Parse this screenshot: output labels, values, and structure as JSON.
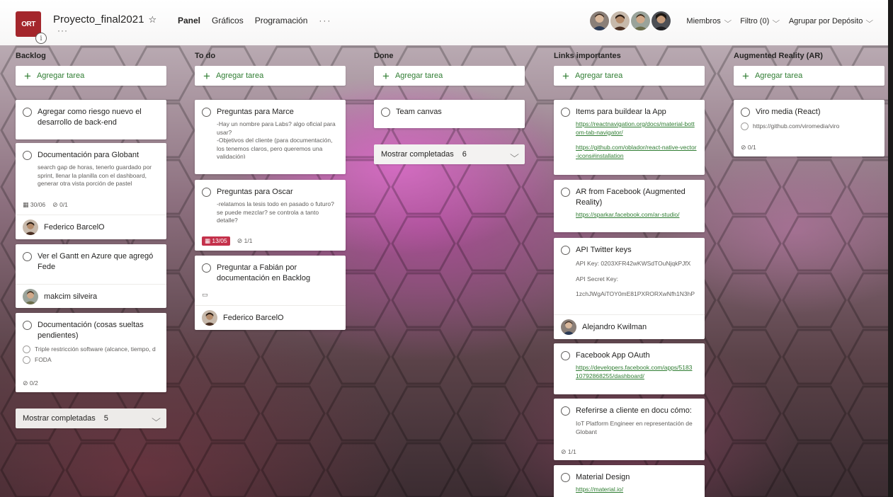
{
  "header": {
    "logo_text": "ORT",
    "info_glyph": "i",
    "plan_title": "Proyecto_final2021",
    "star_glyph": "☆",
    "more_glyph": "···",
    "views": [
      {
        "label": "Panel",
        "active": true
      },
      {
        "label": "Gráficos",
        "active": false
      },
      {
        "label": "Programación",
        "active": false
      }
    ],
    "views_more": "···",
    "members_label": "Miembros",
    "filter_label": "Filtro (0)",
    "group_label": "Agrupar por Depósito",
    "chevron_glyph": "⌵"
  },
  "add_task_label": "Agregar tarea",
  "show_completed_label": "Mostrar completadas",
  "columns": [
    {
      "title": "Backlog",
      "cards": [
        {
          "title": "Agregar como riesgo nuevo el desarrollo de back-end"
        },
        {
          "title": "Documentación para Globant",
          "notes": "search gap de horas, tenerlo guardado por sprint, llenar la planilla con el dashboard, generar otra vista porción de pastel",
          "date": "30/06",
          "checklist": "0/1",
          "assignee": "Federico BarcelO"
        },
        {
          "title": "Ver el Gantt en Azure que agregó Fede",
          "assignee": "makcim silveira"
        },
        {
          "title": "Documentación (cosas sueltas pendientes)",
          "items": [
            "Triple restricción software (alcance, tiempo, d",
            "FODA"
          ],
          "checklist": "0/2"
        }
      ],
      "completed_count": "5"
    },
    {
      "title": "To do",
      "cards": [
        {
          "title": "Preguntas para Marce",
          "notes_lines": [
            "-Hay un nombre para Labs? algo oficial para usar?",
            "-Objetivos del cliente (para documentación, los tenemos claros, pero queremos una validación)"
          ]
        },
        {
          "title": "Preguntas para Oscar",
          "notes": "-relatamos la tesis todo en pasado o futuro? se puede mezclar? se controla a tanto detalle?",
          "date": "13/05",
          "checklist": "1/1"
        },
        {
          "title": "Preguntar a Fabián por documentación en Backlog",
          "assignee": "Federico BarcelO"
        }
      ]
    },
    {
      "title": "Done",
      "cards": [
        {
          "title": "Team canvas"
        }
      ],
      "completed_count": "6"
    },
    {
      "title": "Links importantes",
      "cards": [
        {
          "title": "Items para buildear la App",
          "links": [
            "https://reactnavigation.org/docs/material-bottom-tab-navigator/",
            "https://github.com/oblador/react-native-vector-icons#installation"
          ]
        },
        {
          "title": "AR from Facebook (Augmented Reality)",
          "links": [
            "https://sparkar.facebook.com/ar-studio/"
          ]
        },
        {
          "title": "API Twitter keys",
          "notes_lines": [
            "API Key: 0203XFR42wKWSdTOuNjqkPJfX",
            "API Secret Key:",
            "1zchJWgAiTOY0mE81PXRORXwNfh1N3hP"
          ],
          "assignee": "Alejandro Kwilman"
        },
        {
          "title": "Facebook App OAuth",
          "links": [
            "https://developers.facebook.com/apps/518310792868255/dashboard/"
          ]
        },
        {
          "title": "Referirse a cliente en docu cómo:",
          "notes": "IoT Platform Engineer en representación de Globant",
          "checklist": "1/1"
        },
        {
          "title": "Material Design",
          "links": [
            "https://material.io/"
          ]
        }
      ]
    },
    {
      "title": "Augmented Reality (AR)",
      "cards": [
        {
          "title": "Viro media (React)",
          "items": [
            "https://github.com/viromedia/viro"
          ],
          "checklist": "0/1"
        }
      ]
    }
  ],
  "icons": {
    "calendar": "calendar-icon",
    "checklist": "checklist-icon",
    "comment": "comment-icon",
    "plus": "plus-icon",
    "chevron": "chevron-down-icon"
  },
  "colors": {
    "accent_green": "#2f7d32",
    "overdue_red": "#c4314b",
    "logo_red": "#a4262c"
  }
}
